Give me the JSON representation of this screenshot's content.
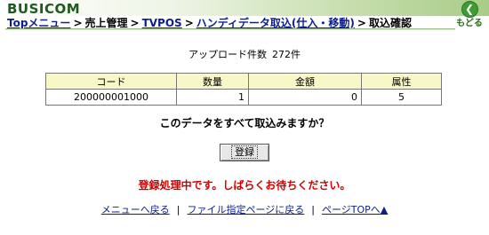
{
  "header": {
    "brand": "BUSICOM",
    "back_label": "もどる",
    "back_icon": "arrow-left-icon",
    "accent_color": "#3e9b34"
  },
  "breadcrumb": {
    "items": [
      {
        "label": "Topメニュー",
        "link": true
      },
      {
        "label": "売上管理",
        "link": false
      },
      {
        "label": "TVPOS",
        "link": true
      },
      {
        "label": "ハンディデータ取込(仕入・移動)",
        "link": true
      },
      {
        "label": "取込確認",
        "link": false
      }
    ],
    "separator": ">"
  },
  "upload": {
    "label": "アップロード件数",
    "count": "272件"
  },
  "table": {
    "headers": [
      "コード",
      "数量",
      "金額",
      "属性"
    ],
    "rows": [
      [
        "200000001000",
        "1",
        "0",
        "5"
      ]
    ]
  },
  "confirm": {
    "question": "このデータをすべて取込みますか？",
    "register_label": "登録"
  },
  "status": {
    "processing": "登録処理中です。しばらくお待ちください。",
    "color": "#d00000"
  },
  "footer": {
    "menu_link": "メニューへ戻る",
    "file_link": "ファイル指定ページに戻る",
    "top_link": "ページTOPへ▲",
    "separator": "|"
  }
}
